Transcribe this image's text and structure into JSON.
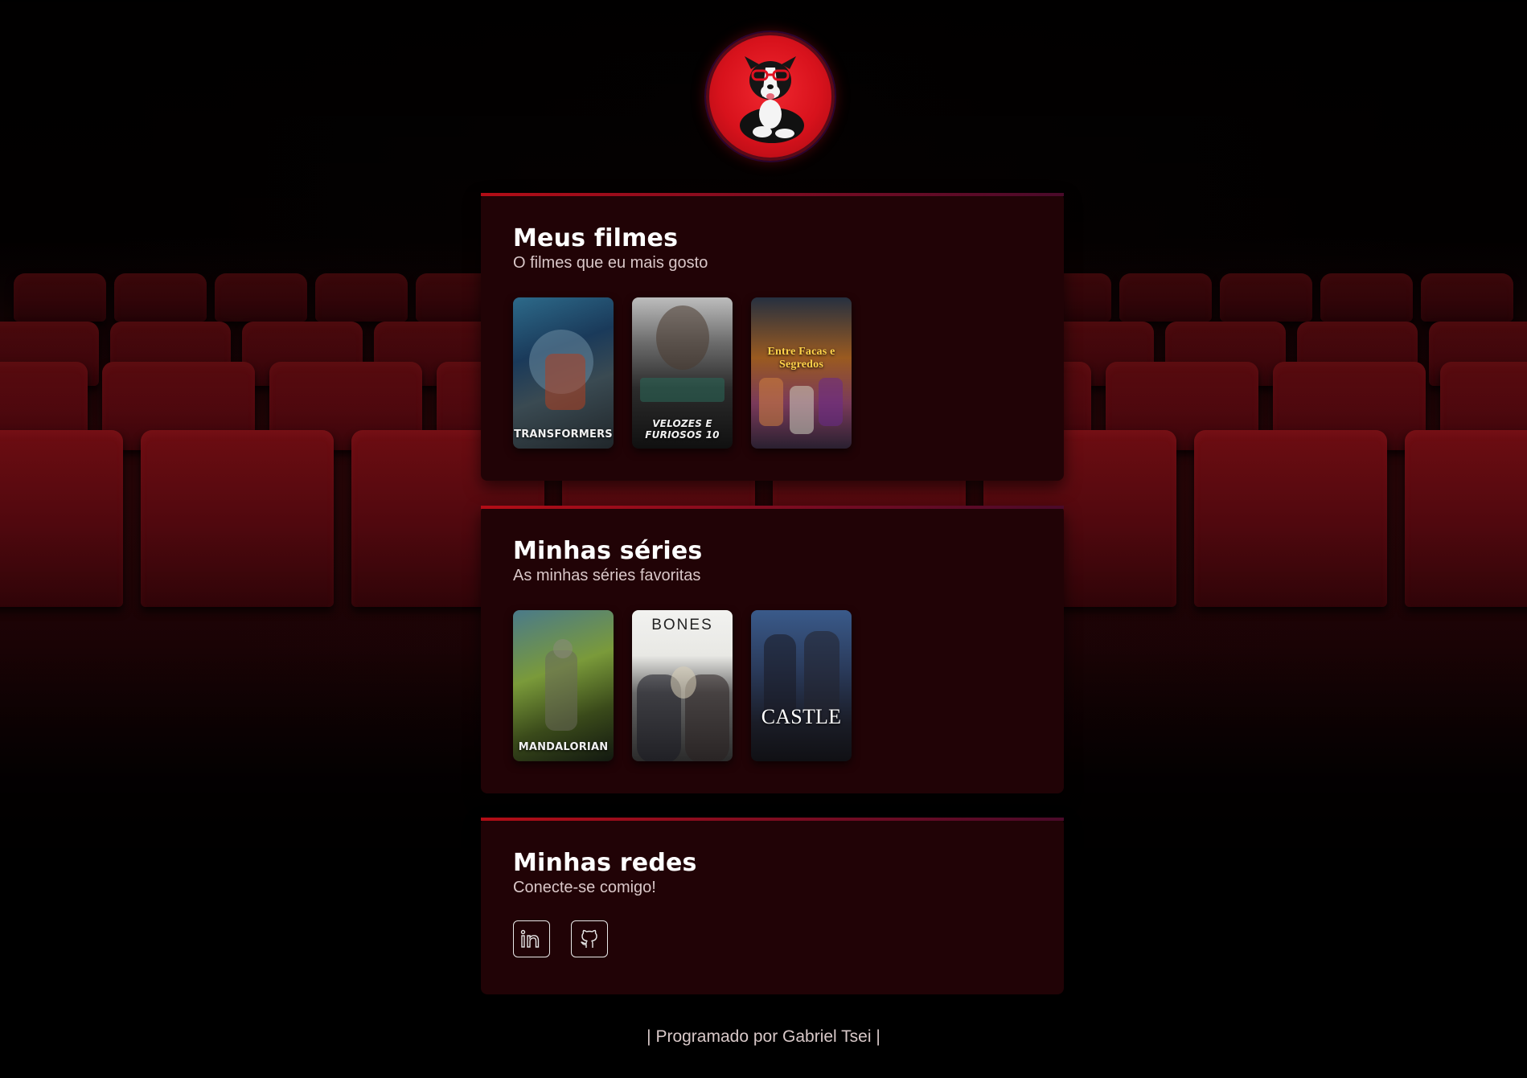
{
  "profile": {
    "avatar_alt": "Foto de perfil"
  },
  "sections": {
    "movies": {
      "title": "Meus filmes",
      "subtitle": "O filmes que eu mais gosto",
      "posters": [
        "TRANSFORMERS",
        "VELOZES E FURIOSOS 10",
        "Entre Facas e Segredos"
      ]
    },
    "series": {
      "title": "Minhas séries",
      "subtitle": "As minhas séries favoritas",
      "posters": [
        "MANDALORIAN",
        "BONES",
        "CASTLE"
      ]
    },
    "socials": {
      "title": "Minhas redes",
      "subtitle": "Conecte-se comigo!",
      "links": [
        {
          "icon": "linkedin-icon"
        },
        {
          "icon": "github-icon"
        }
      ]
    }
  },
  "footer": {
    "text": "| Programado por Gabriel Tsei |"
  },
  "colors": {
    "card_bg": "#210306",
    "accent": "#b30d16",
    "avatar_bg": "#d8121c"
  }
}
